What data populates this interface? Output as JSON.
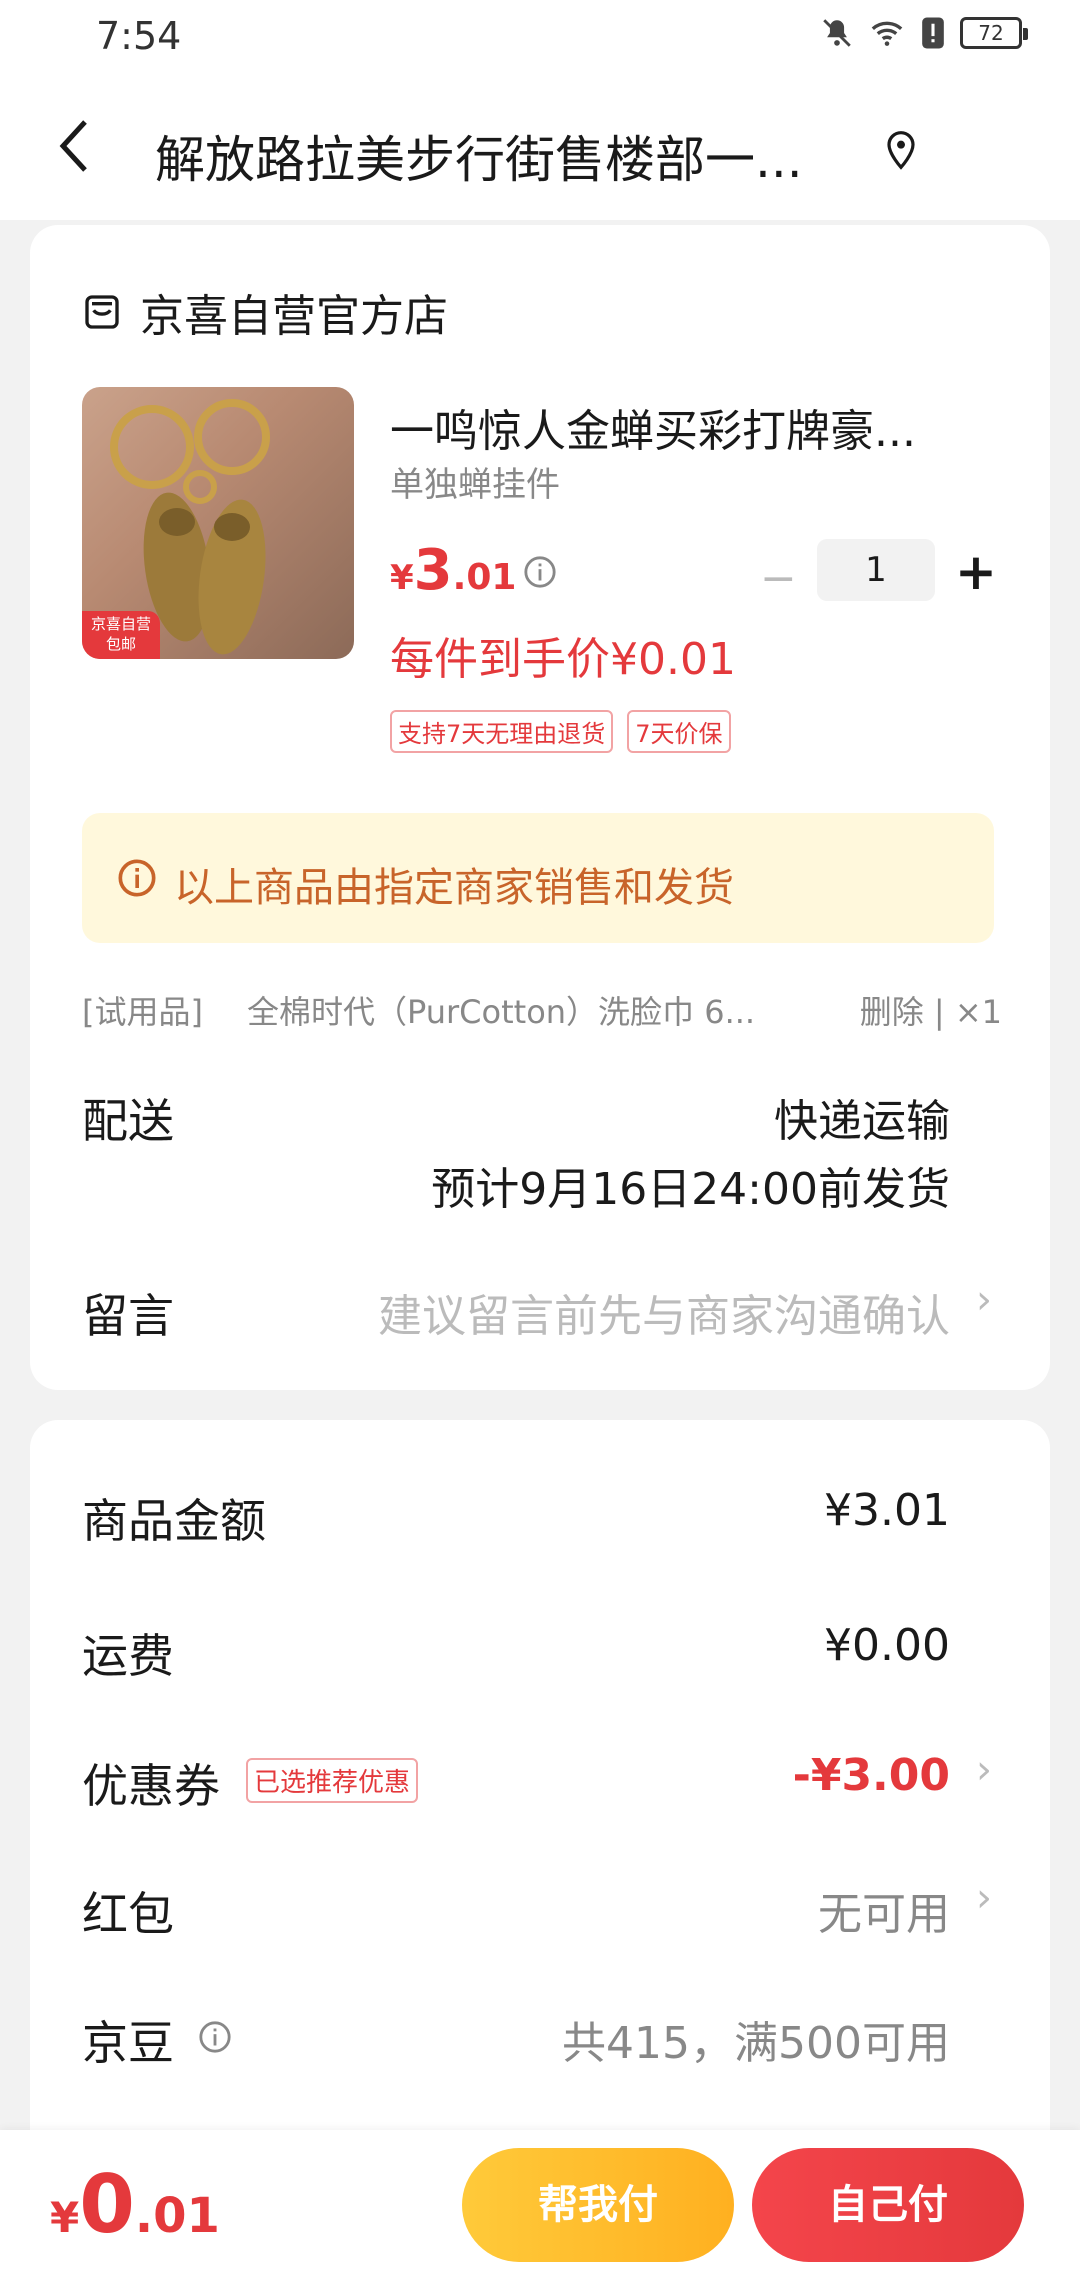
{
  "status_bar": {
    "time": "7:54",
    "battery": "72"
  },
  "header": {
    "title": "解放路拉美步行街售楼部一..."
  },
  "shop": {
    "name": "京喜自营官方店"
  },
  "product": {
    "badge_line1": "京喜自营",
    "badge_line2": "包邮",
    "title": "一鸣惊人金蝉买彩打牌豪...",
    "spec": "单独蝉挂件",
    "price_yen": "¥",
    "price_int": "3",
    "price_dec": ".01",
    "quantity": "1",
    "minus": "−",
    "plus": "+",
    "final_price": "每件到手价¥0.01",
    "tags": [
      "支持7天无理由退货",
      "7天价保"
    ]
  },
  "notice": {
    "text": "以上商品由指定商家销售和发货"
  },
  "gift": {
    "tag": "[试用品]",
    "name": "全棉时代（PurCotton）洗脸巾 6...",
    "ops": "删除 | ×1"
  },
  "delivery": {
    "label": "配送",
    "method": "快递运输",
    "eta": "预计9月16日24:00前发货"
  },
  "message": {
    "label": "留言",
    "placeholder": "建议留言前先与商家沟通确认"
  },
  "summary": {
    "goods_label": "商品金额",
    "goods_value": "¥3.01",
    "shipping_label": "运费",
    "shipping_value": "¥0.00",
    "coupon_label": "优惠券",
    "coupon_tag": "已选推荐优惠",
    "coupon_value": "-¥3.00",
    "redpack_label": "红包",
    "redpack_value": "无可用",
    "jingdou_label": "京豆",
    "jingdou_value": "共415，满500可用"
  },
  "bottom": {
    "total_yen": "¥",
    "total_int": "0",
    "total_dec": ".01",
    "help_pay": "帮我付",
    "self_pay": "自己付"
  },
  "colors": {
    "accent_red": "#e4393c",
    "accent_yellow": "#ffb020",
    "notice_bg": "#fff8dc"
  }
}
